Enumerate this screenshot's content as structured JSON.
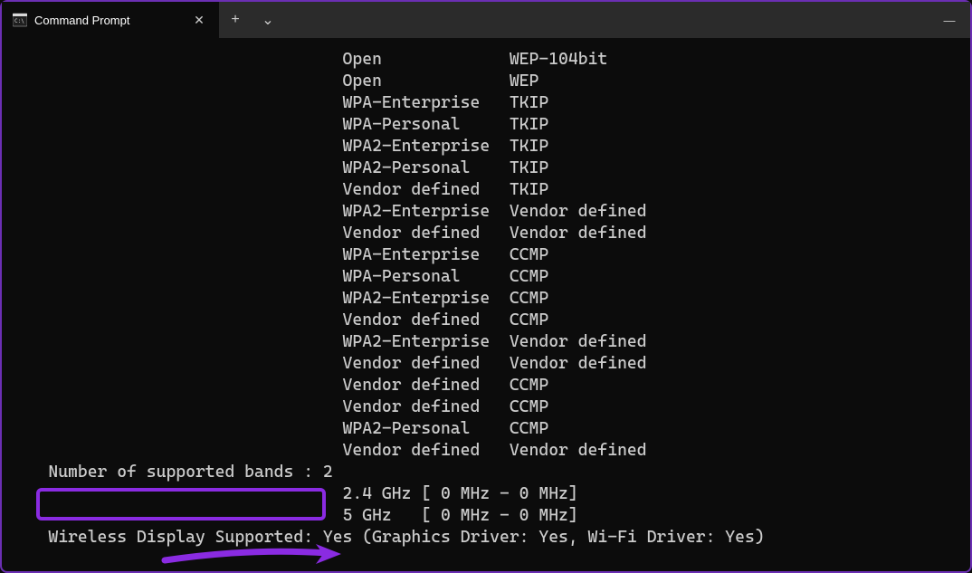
{
  "window": {
    "tab_title": "Command Prompt",
    "new_tab_glyph": "+",
    "dropdown_glyph": "⌄",
    "close_tab_glyph": "✕",
    "minimize_glyph": "—"
  },
  "terminal": {
    "indent_main": "                                  ",
    "indent_sub": "    ",
    "auth_pairs": [
      {
        "auth": "Open           ",
        "cipher": "WEP-104bit"
      },
      {
        "auth": "Open           ",
        "cipher": "WEP"
      },
      {
        "auth": "WPA-Enterprise ",
        "cipher": "TKIP"
      },
      {
        "auth": "WPA-Personal   ",
        "cipher": "TKIP"
      },
      {
        "auth": "WPA2-Enterprise",
        "cipher": "TKIP"
      },
      {
        "auth": "WPA2-Personal  ",
        "cipher": "TKIP"
      },
      {
        "auth": "Vendor defined ",
        "cipher": "TKIP"
      },
      {
        "auth": "WPA2-Enterprise",
        "cipher": "Vendor defined"
      },
      {
        "auth": "Vendor defined ",
        "cipher": "Vendor defined"
      },
      {
        "auth": "WPA-Enterprise ",
        "cipher": "CCMP"
      },
      {
        "auth": "WPA-Personal   ",
        "cipher": "CCMP"
      },
      {
        "auth": "WPA2-Enterprise",
        "cipher": "CCMP"
      },
      {
        "auth": "Vendor defined ",
        "cipher": "CCMP"
      },
      {
        "auth": "WPA2-Enterprise",
        "cipher": "Vendor defined"
      },
      {
        "auth": "Vendor defined ",
        "cipher": "Vendor defined"
      },
      {
        "auth": "Vendor defined ",
        "cipher": "CCMP"
      },
      {
        "auth": "Vendor defined ",
        "cipher": "CCMP"
      },
      {
        "auth": "WPA2-Personal  ",
        "cipher": "CCMP"
      },
      {
        "auth": "Vendor defined ",
        "cipher": "Vendor defined"
      }
    ],
    "bands_label": "Number of supported bands",
    "bands_sep": " : ",
    "bands_count": "2",
    "band_lines": [
      "2.4 GHz [ 0 MHz - 0 MHz]",
      "5 GHz   [ 0 MHz - 0 MHz]"
    ],
    "wireless_display_label": "Wireless Display Supported",
    "wireless_display_sep": ": ",
    "wireless_display_value": "Yes (Graphics Driver: Yes, Wi-Fi Driver: Yes)",
    "left_pad": "    "
  },
  "annotations": {
    "highlight_color": "#8a2be2"
  }
}
